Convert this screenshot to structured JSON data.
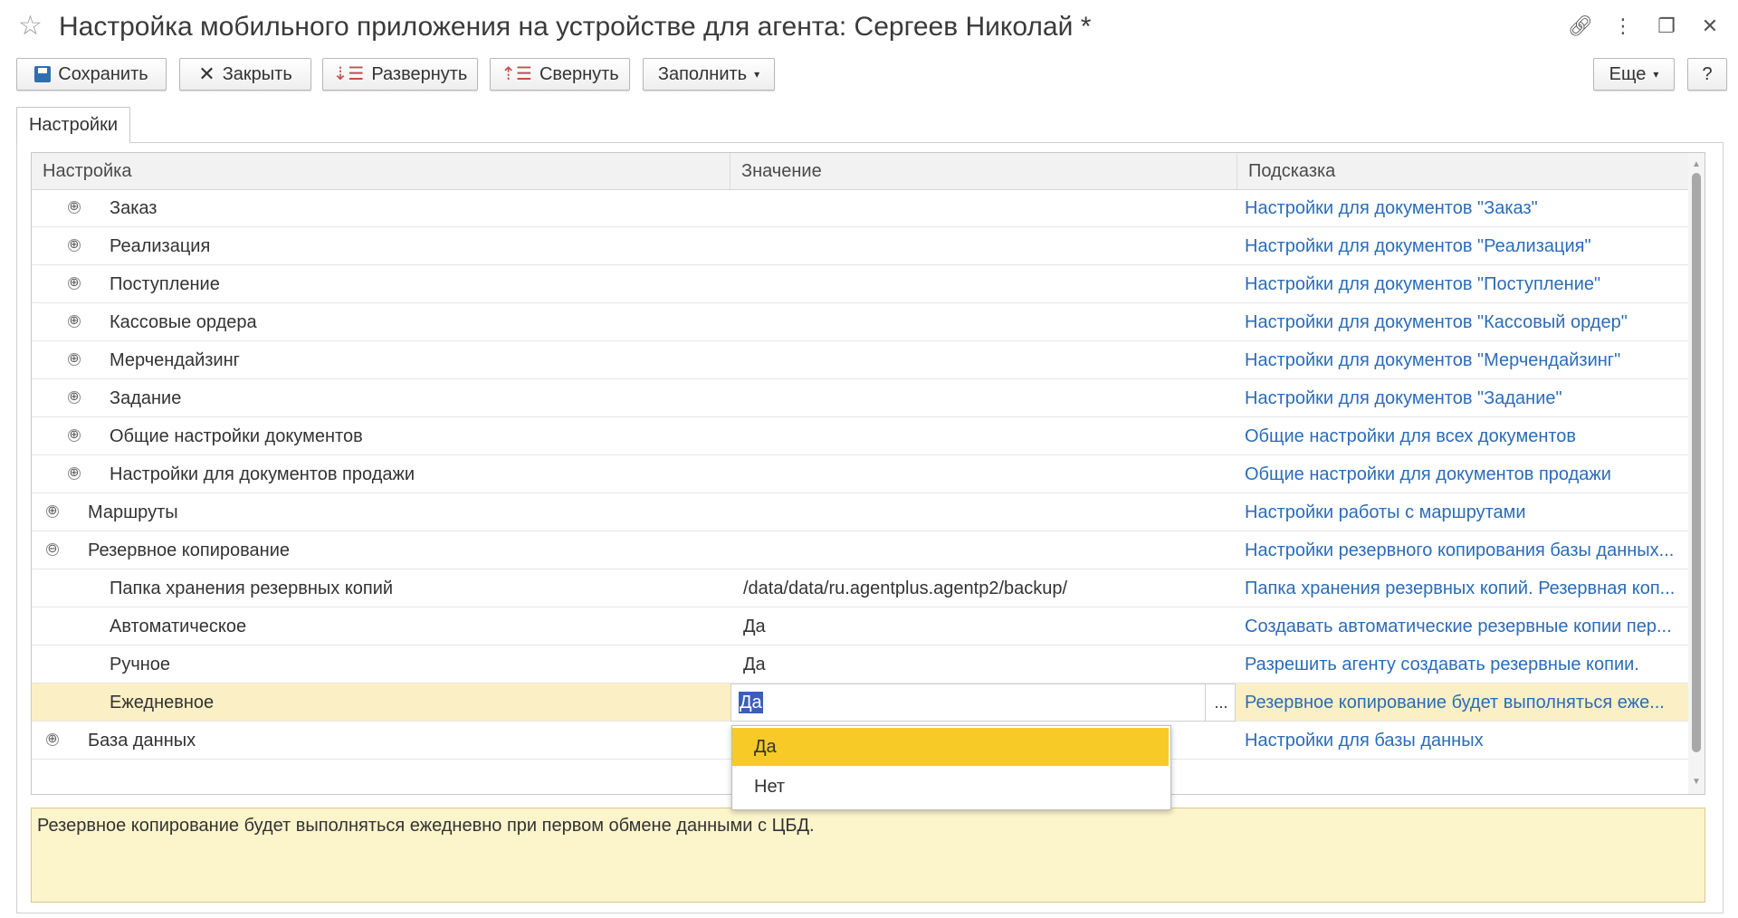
{
  "window": {
    "title": "Настройка мобильного приложения на устройстве для агента: Сергеев Николай *",
    "icons": [
      "star-icon",
      "link-icon",
      "more-vertical-icon",
      "restore-icon",
      "close-icon"
    ]
  },
  "toolbar": {
    "save": "Сохранить",
    "close": "Закрыть",
    "expand": "Развернуть",
    "collapse": "Свернуть",
    "fill": "Заполнить",
    "more": "Еще",
    "help": "?"
  },
  "tabs": [
    {
      "label": "Настройки"
    }
  ],
  "grid": {
    "columns": {
      "setting": "Настройка",
      "value": "Значение",
      "hint": "Подсказка"
    },
    "rows": [
      {
        "name": "Заказ",
        "value": "",
        "hint": "Настройки для документов \"Заказ\"",
        "level": 1,
        "toggle": "⊕"
      },
      {
        "name": "Реализация",
        "value": "",
        "hint": "Настройки для документов \"Реализация\"",
        "level": 1,
        "toggle": "⊕"
      },
      {
        "name": "Поступление",
        "value": "",
        "hint": "Настройки для документов \"Поступление\"",
        "level": 1,
        "toggle": "⊕"
      },
      {
        "name": "Кассовые ордера",
        "value": "",
        "hint": "Настройки для документов \"Кассовый ордер\"",
        "level": 1,
        "toggle": "⊕"
      },
      {
        "name": "Мерчендайзинг",
        "value": "",
        "hint": "Настройки для документов \"Мерчендайзинг\"",
        "level": 1,
        "toggle": "⊕"
      },
      {
        "name": "Задание",
        "value": "",
        "hint": "Настройки для документов \"Задание\"",
        "level": 1,
        "toggle": "⊕"
      },
      {
        "name": "Общие настройки документов",
        "value": "",
        "hint": "Общие настройки для всех документов",
        "level": 1,
        "toggle": "⊕"
      },
      {
        "name": "Настройки для документов продажи",
        "value": "",
        "hint": "Общие настройки для документов продажи",
        "level": 1,
        "toggle": "⊕"
      },
      {
        "name": "Маршруты",
        "value": "",
        "hint": "Настройки работы с маршрутами",
        "level": 0,
        "toggle": "⊕"
      },
      {
        "name": "Резервное копирование",
        "value": "",
        "hint": "Настройки резервного копирования базы данных...",
        "level": 0,
        "toggle": "⊖"
      },
      {
        "name": "Папка хранения резервных копий",
        "value": "/data/data/ru.agentplus.agentp2/backup/",
        "hint": "Папка хранения резервных копий. Резервная коп...",
        "level": 2,
        "toggle": ""
      },
      {
        "name": "Автоматическое",
        "value": "Да",
        "hint": "Создавать автоматические резервные копии пер...",
        "level": 2,
        "toggle": ""
      },
      {
        "name": "Ручное",
        "value": "Да",
        "hint": "Разрешить агенту создавать резервные копии.",
        "level": 2,
        "toggle": ""
      },
      {
        "name": "Ежедневное",
        "value": "Да",
        "hint": "Резервное копирование будет выполняться еже...",
        "level": 2,
        "toggle": "",
        "selected": true
      },
      {
        "name": "База данных",
        "value": "",
        "hint": "Настройки для базы данных",
        "level": 0,
        "toggle": "⊕"
      }
    ]
  },
  "dropdown": {
    "options": [
      "Да",
      "Нет"
    ],
    "selected": "Да"
  },
  "hint_box": {
    "text": "Резервное копирование будет выполняться ежедневно при первом обмене данными с ЦБД."
  },
  "colors": {
    "link": "#2b6cb8",
    "selected_row": "#fbefc5",
    "dropdown_active": "#f8ca28",
    "hint_box": "#fcf4cb"
  }
}
